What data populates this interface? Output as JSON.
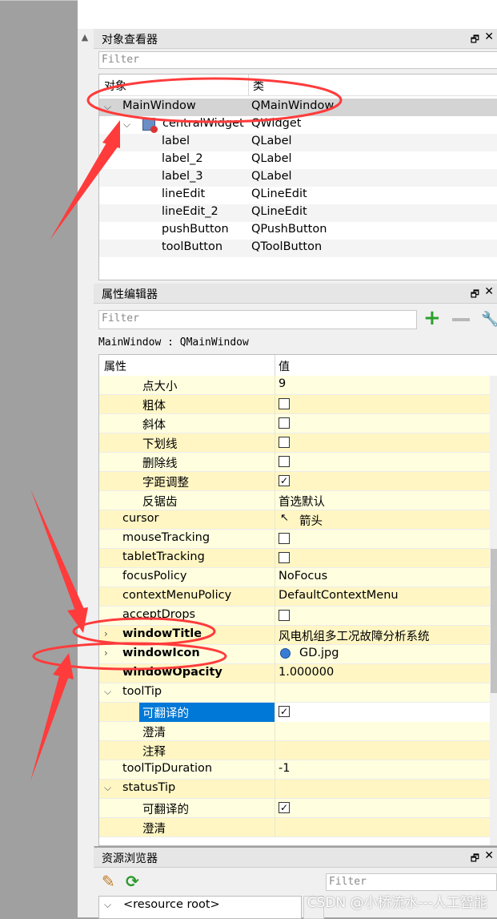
{
  "object_inspector": {
    "title": "对象查看器",
    "filter_placeholder": "Filter",
    "col_object": "对象",
    "col_class": "类",
    "rows": [
      {
        "name": "MainWindow",
        "cls": "QMainWindow"
      },
      {
        "name": "centralWidget",
        "cls": "QWidget"
      },
      {
        "name": "label",
        "cls": "QLabel"
      },
      {
        "name": "label_2",
        "cls": "QLabel"
      },
      {
        "name": "label_3",
        "cls": "QLabel"
      },
      {
        "name": "lineEdit",
        "cls": "QLineEdit"
      },
      {
        "name": "lineEdit_2",
        "cls": "QLineEdit"
      },
      {
        "name": "pushButton",
        "cls": "QPushButton"
      },
      {
        "name": "toolButton",
        "cls": "QToolButton"
      }
    ]
  },
  "property_editor": {
    "title": "属性编辑器",
    "filter_placeholder": "Filter",
    "context": "MainWindow : QMainWindow",
    "col_property": "属性",
    "col_value": "值",
    "rows": [
      {
        "name": "点大小",
        "value": "9"
      },
      {
        "name": "粗体",
        "value": ""
      },
      {
        "name": "斜体",
        "value": ""
      },
      {
        "name": "下划线",
        "value": ""
      },
      {
        "name": "删除线",
        "value": ""
      },
      {
        "name": "字距调整",
        "value": ""
      },
      {
        "name": "反锯齿",
        "value": "首选默认"
      },
      {
        "name": "cursor",
        "value": "箭头"
      },
      {
        "name": "mouseTracking",
        "value": ""
      },
      {
        "name": "tabletTracking",
        "value": ""
      },
      {
        "name": "focusPolicy",
        "value": "NoFocus"
      },
      {
        "name": "contextMenuPolicy",
        "value": "DefaultContextMenu"
      },
      {
        "name": "acceptDrops",
        "value": ""
      },
      {
        "name": "windowTitle",
        "value": "风电机组多工况故障分析系统"
      },
      {
        "name": "windowIcon",
        "value": "GD.jpg"
      },
      {
        "name": "windowOpacity",
        "value": "1.000000"
      },
      {
        "name": "toolTip",
        "value": ""
      },
      {
        "name": "可翻译的",
        "value": ""
      },
      {
        "name": "澄清",
        "value": ""
      },
      {
        "name": "注释",
        "value": ""
      },
      {
        "name": "toolTipDuration",
        "value": "-1"
      },
      {
        "name": "statusTip",
        "value": ""
      },
      {
        "name": "可翻译的",
        "value": ""
      },
      {
        "name": "澄清",
        "value": ""
      }
    ]
  },
  "resource_browser": {
    "title": "资源浏览器",
    "filter_placeholder": "Filter",
    "root": "<resource root>"
  },
  "watermark": "CSDN @小桥流水---人工智能",
  "colors": {
    "arrow": "#ff3b3b",
    "selection": "#0078d7",
    "prop_bg": "#ffffe0"
  }
}
